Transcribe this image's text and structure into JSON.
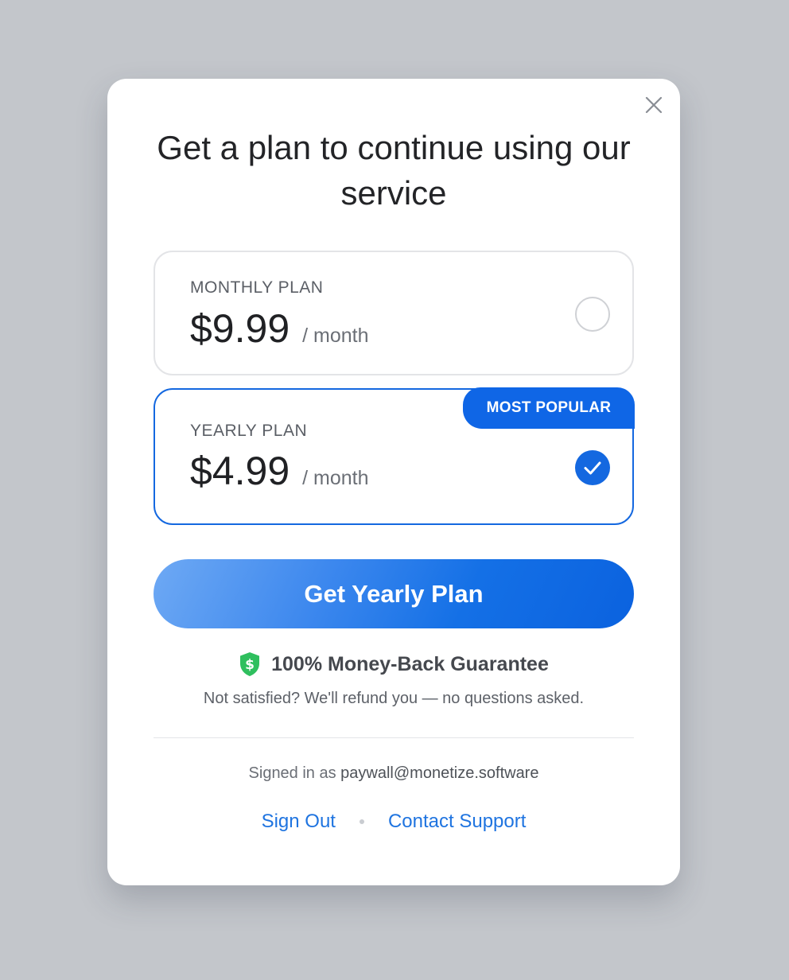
{
  "modal": {
    "title": "Get a plan to continue using our service",
    "close_icon": "close-icon"
  },
  "plans": [
    {
      "name": "MONTHLY PLAN",
      "price": "$9.99",
      "period": "/ month",
      "selected": false
    },
    {
      "name": "YEARLY PLAN",
      "price": "$4.99",
      "period": "/ month",
      "selected": true,
      "badge": "MOST POPULAR"
    }
  ],
  "cta": {
    "label": "Get Yearly Plan"
  },
  "guarantee": {
    "icon": "shield-dollar-icon",
    "title": "100% Money-Back Guarantee",
    "description": "Not satisfied? We'll refund you — no questions asked."
  },
  "account": {
    "signed_in_prefix": "Signed in as",
    "email": "paywall@monetize.software"
  },
  "links": {
    "sign_out": "Sign Out",
    "contact_support": "Contact Support"
  },
  "colors": {
    "accent": "#1468e0",
    "badge": "#0f66e6",
    "guarantee_icon": "#2fbf5e",
    "link": "#1f74e0",
    "backdrop": "#c3c6cb"
  }
}
